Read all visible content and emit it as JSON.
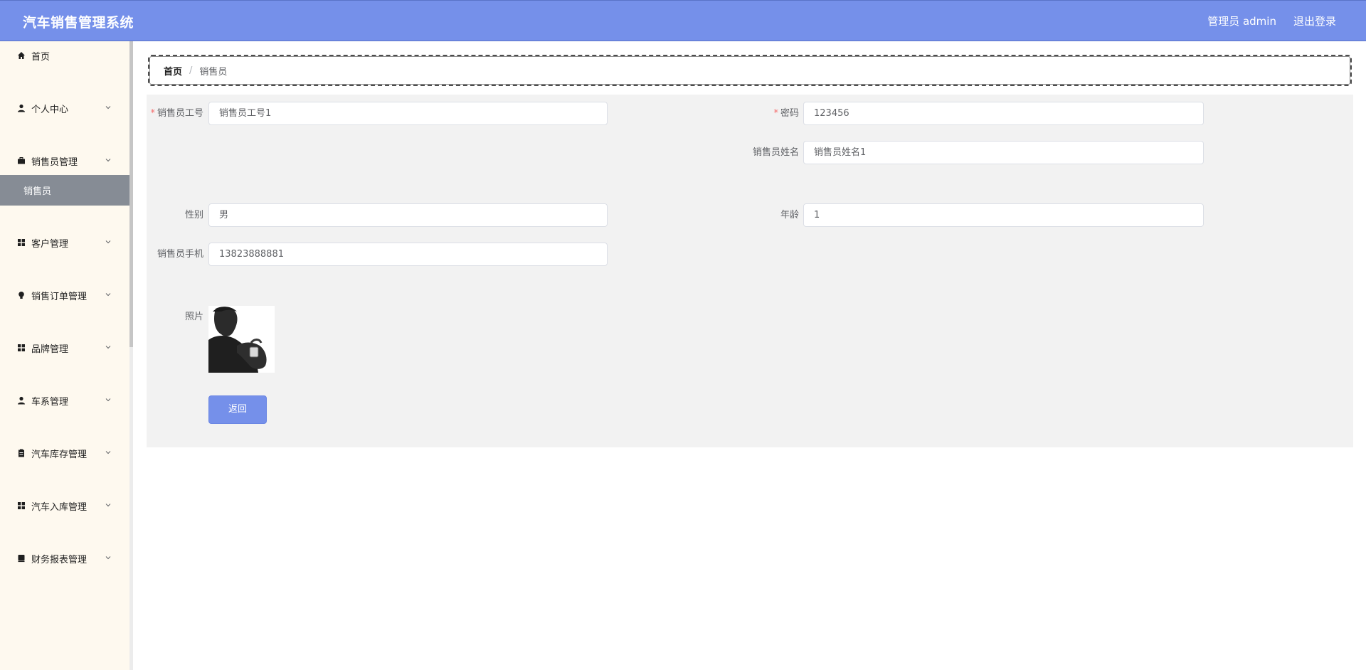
{
  "header": {
    "title": "汽车销售管理系统",
    "user_label": "管理员 admin",
    "logout_label": "退出登录"
  },
  "sidebar": {
    "items": [
      {
        "label": "首页",
        "icon": "home-icon"
      },
      {
        "label": "个人中心",
        "icon": "person-icon"
      },
      {
        "label": "销售员管理",
        "icon": "briefcase-icon"
      },
      {
        "label": "客户管理",
        "icon": "grid-icon"
      },
      {
        "label": "销售订单管理",
        "icon": "lightbulb-icon"
      },
      {
        "label": "品牌管理",
        "icon": "grid-icon"
      },
      {
        "label": "车系管理",
        "icon": "person-icon"
      },
      {
        "label": "汽车库存管理",
        "icon": "clipboard-icon"
      },
      {
        "label": "汽车入库管理",
        "icon": "grid-icon"
      },
      {
        "label": "财务报表管理",
        "icon": "book-icon"
      }
    ],
    "active_subitem": "销售员"
  },
  "breadcrumb": {
    "home": "首页",
    "separator": "/",
    "current": "销售员"
  },
  "form": {
    "employee_no_label": "销售员工号",
    "employee_no_value": "销售员工号1",
    "password_label": "密码",
    "password_value": "123456",
    "name_label": "销售员姓名",
    "name_value": "销售员姓名1",
    "gender_label": "性别",
    "gender_value": "男",
    "age_label": "年龄",
    "age_value": "1",
    "phone_label": "销售员手机",
    "phone_value": "13823888881",
    "photo_label": "照片",
    "required_mark": "*",
    "back_button": "返回"
  },
  "colors": {
    "accent": "#7590ea",
    "sidebar_bg": "#fef9ef",
    "active_item_bg": "#868c95",
    "panel_bg": "#f2f2f2",
    "required": "#f56c6c"
  }
}
